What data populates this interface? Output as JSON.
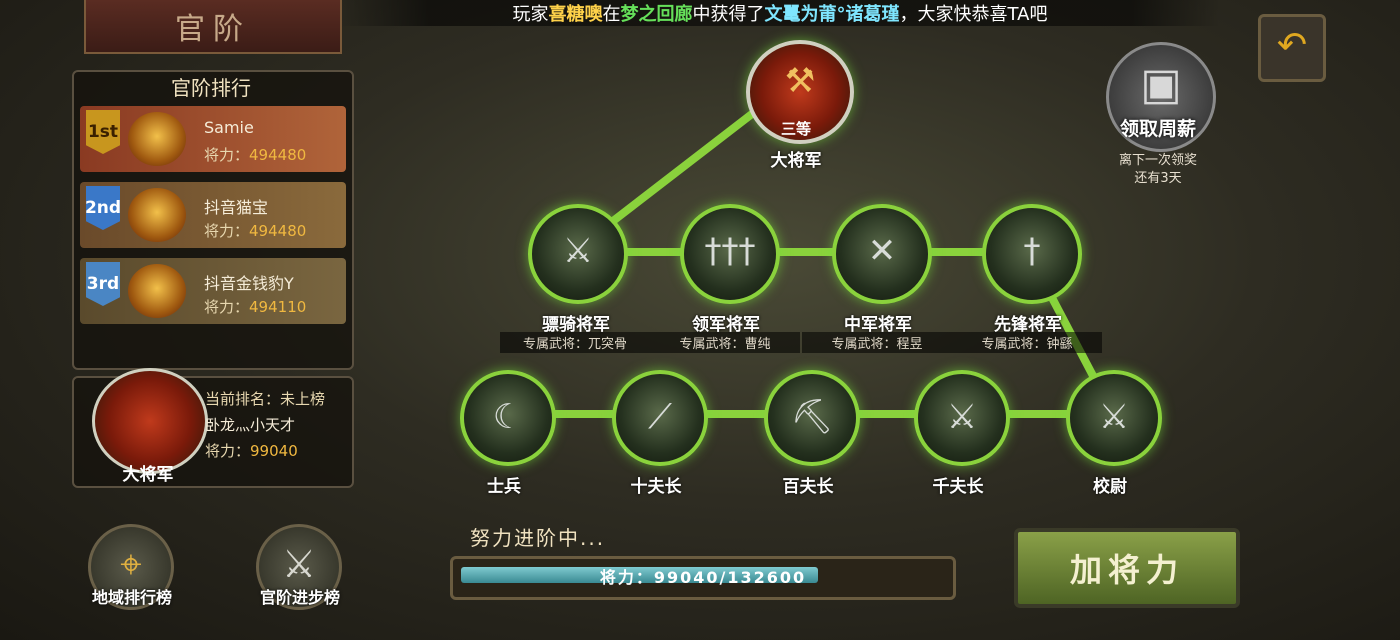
{
  "ticker": {
    "p1": "玩家",
    "player": "喜糖噢",
    "p2": "在",
    "place": "梦之回廊",
    "p3": "中获得了",
    "item": "文鼍为莆°诸葛瑾",
    "p4": "，大家快恭喜TA吧"
  },
  "title": "官阶",
  "ranking": {
    "header": "官阶排行",
    "entries": [
      {
        "medal": "1st",
        "name": "Samie",
        "power_label": "将力：",
        "power": "494480"
      },
      {
        "medal": "2nd",
        "name": "抖音猫宝",
        "power_label": "将力：",
        "power": "494480"
      },
      {
        "medal": "3rd",
        "name": "抖音金钱豹Y",
        "power_label": "将力：",
        "power": "494110"
      }
    ]
  },
  "me": {
    "rank_title": "大将军",
    "rank_line": "当前排名：",
    "rank_value": "未上榜",
    "name": "卧龙灬小天才",
    "power_label": "将力：",
    "power": "99040"
  },
  "bottom_buttons": {
    "region": "地域排行榜",
    "progress": "官阶进步榜"
  },
  "tree": {
    "top": {
      "label": "大将军",
      "badge": "三等"
    },
    "middle": [
      {
        "label": "骠骑将军",
        "sub": "专属武将：兀突骨"
      },
      {
        "label": "领军将军",
        "sub": "专属武将：曹纯"
      },
      {
        "label": "中军将军",
        "sub": "专属武将：程昱"
      },
      {
        "label": "先锋将军",
        "sub": "专属武将：钟繇"
      }
    ],
    "bottom": [
      {
        "label": "士兵"
      },
      {
        "label": "十夫长"
      },
      {
        "label": "百夫长"
      },
      {
        "label": "千夫长"
      },
      {
        "label": "校尉"
      }
    ]
  },
  "progress": {
    "status": "努力进阶中...",
    "text": "将力：99040/132600",
    "current": 99040,
    "target": 132600
  },
  "add_power_button": "加将力",
  "weekly": {
    "label": "领取周薪",
    "note_line1": "离下一次领奖",
    "note_line2": "还有3天"
  },
  "colors": {
    "accent_green": "#8ad23c",
    "gold": "#f0b840"
  }
}
